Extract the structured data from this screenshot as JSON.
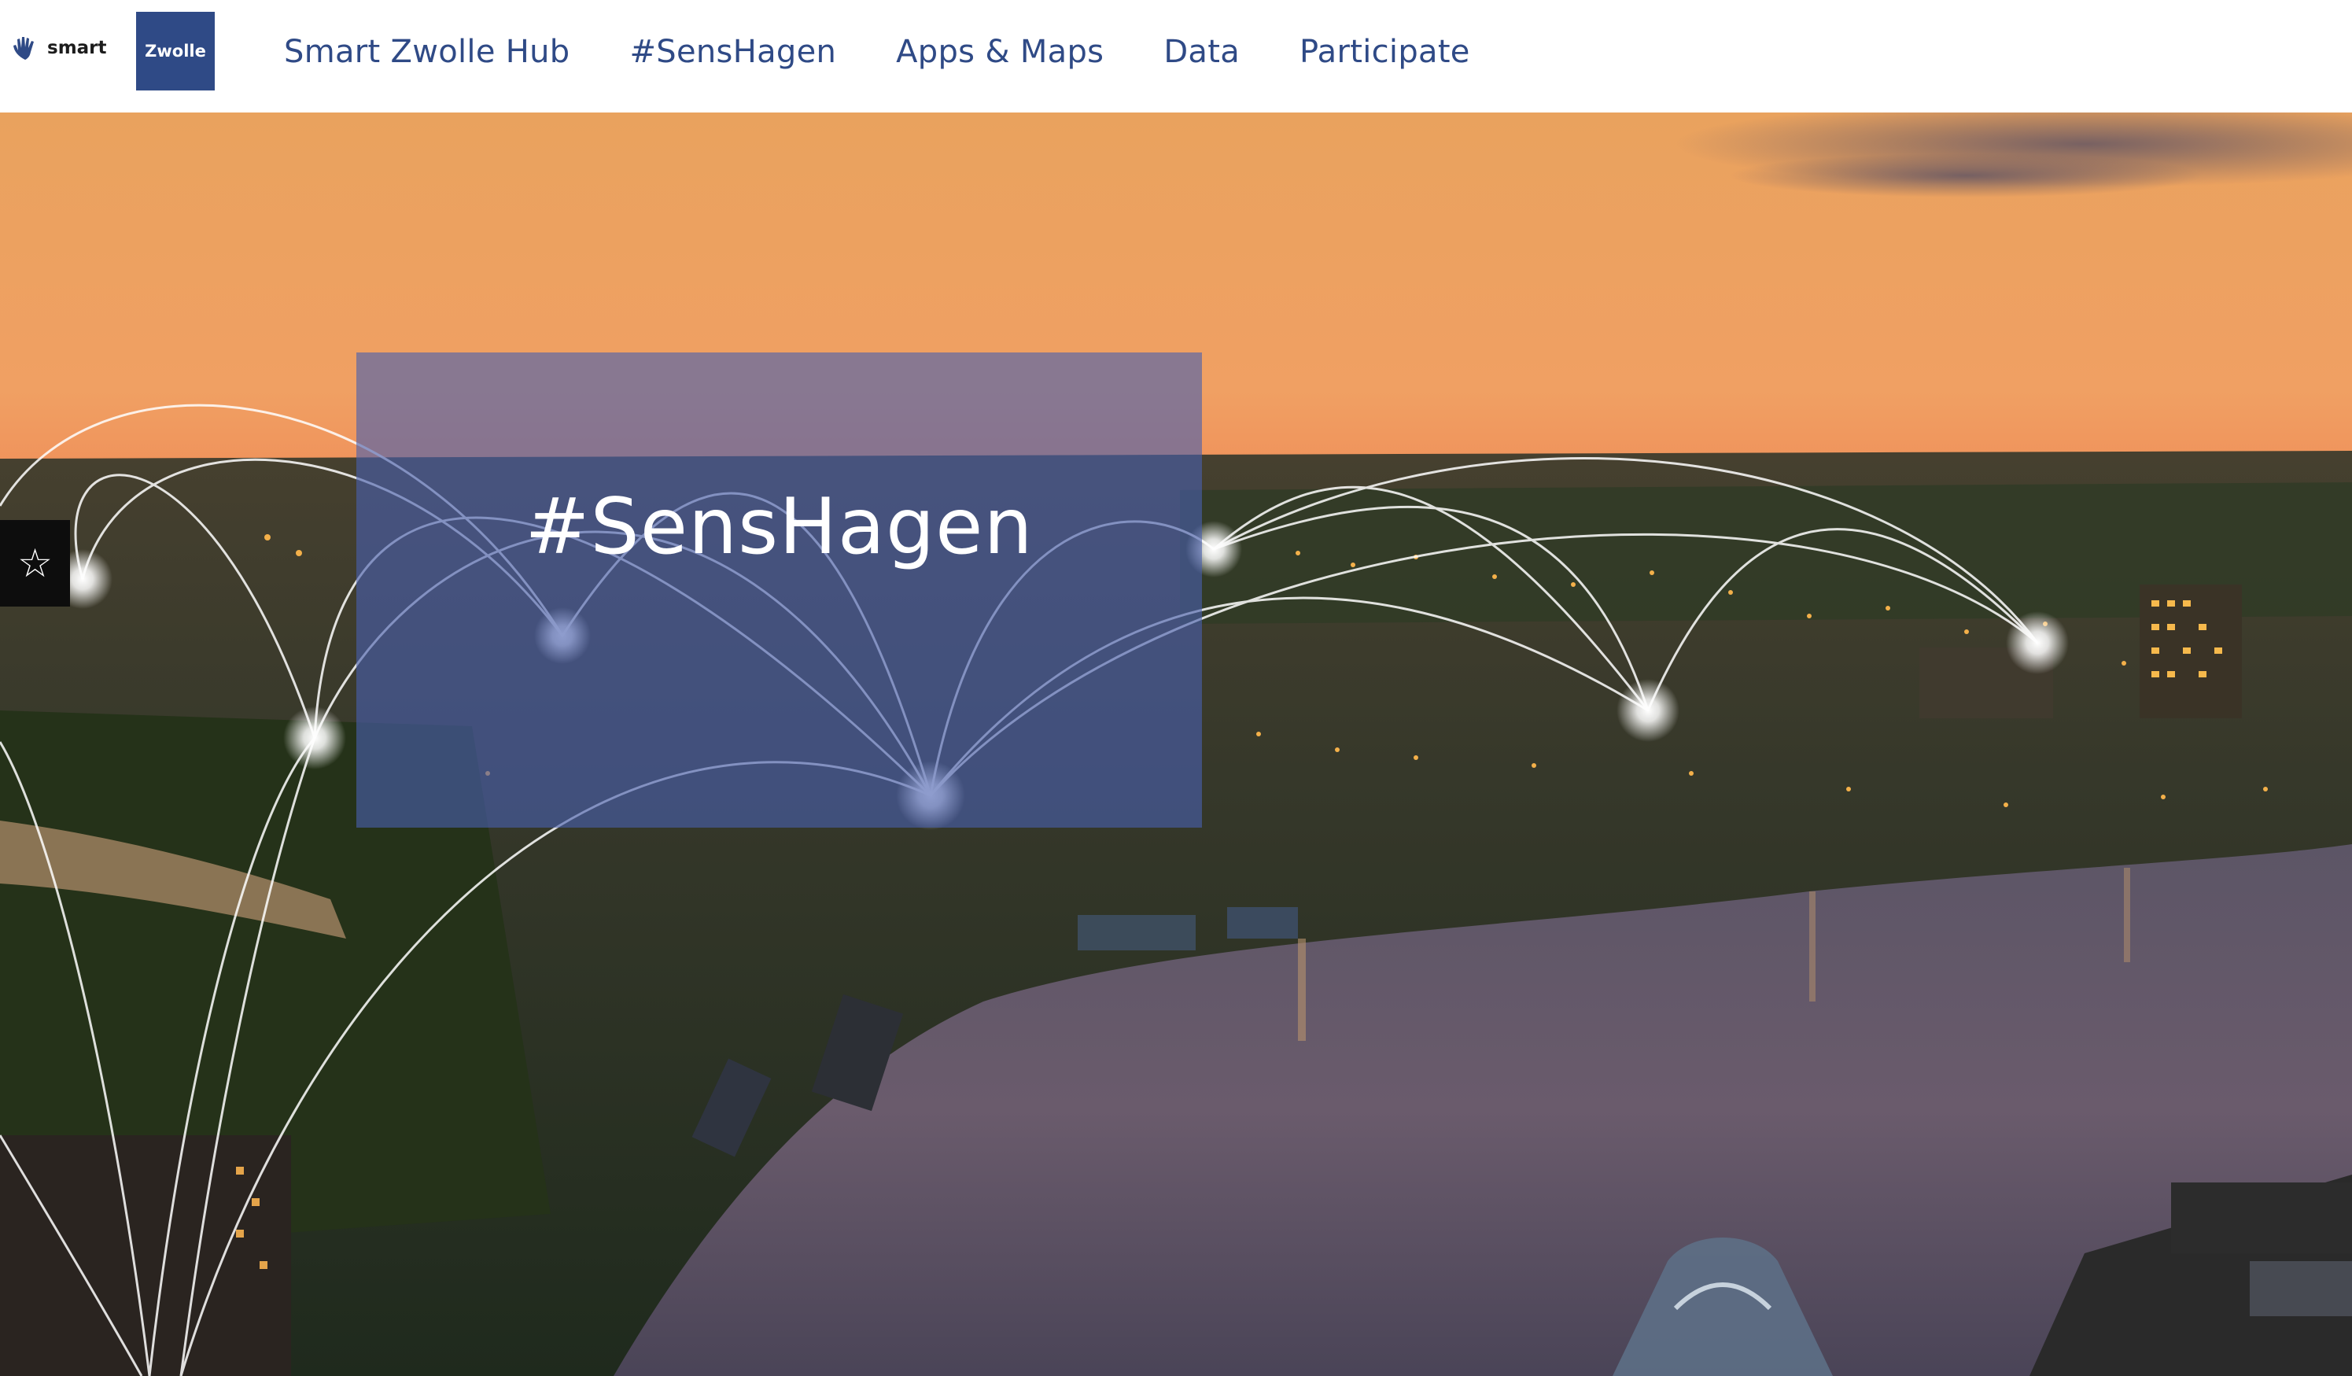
{
  "brand": {
    "smart_label": "smart",
    "city_label": "Zwolle",
    "city_color": "#2f4a86"
  },
  "nav": {
    "items": [
      {
        "label": "Smart Zwolle Hub"
      },
      {
        "label": "#SensHagen"
      },
      {
        "label": "Apps & Maps"
      },
      {
        "label": "Data"
      },
      {
        "label": "Participate"
      }
    ],
    "color": "#2f4a86"
  },
  "hero": {
    "title": "#SensHagen",
    "overlay_color": "#495faf"
  },
  "side_tab": {
    "icon": "star-outline-icon",
    "glyph": "☆"
  }
}
